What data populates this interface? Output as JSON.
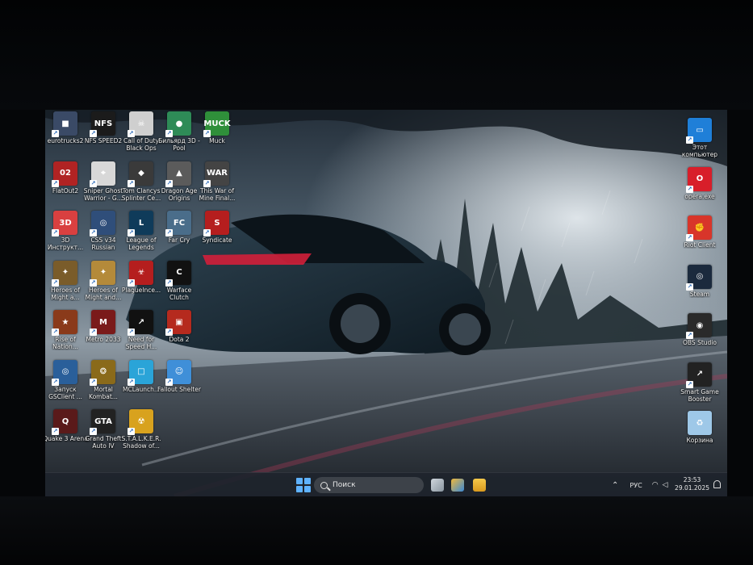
{
  "desktop_icons_left": [
    {
      "label": "eurotrucks2",
      "icon": "truck-icon",
      "color": "#3a4a66",
      "glyph": "■"
    },
    {
      "label": "NFS SPEED2",
      "icon": "nfs-icon",
      "color": "#1b1b1b",
      "glyph": "NFS"
    },
    {
      "label": "Call of Duty Black Ops",
      "icon": "skull-icon",
      "color": "#cfcfcf",
      "glyph": "☠"
    },
    {
      "label": "Бильярд 3D - Pool",
      "icon": "billiard-icon",
      "color": "#2e8b57",
      "glyph": "●"
    },
    {
      "label": "Muck",
      "icon": "muck-icon",
      "color": "#2f8f3a",
      "glyph": "MUCK"
    },
    {
      "label": "FlatOut2",
      "icon": "flatout-icon",
      "color": "#b02323",
      "glyph": "02"
    },
    {
      "label": "Sniper Ghost Warrior - G...",
      "icon": "crosshair-icon",
      "color": "#d8d8d8",
      "glyph": "⌖"
    },
    {
      "label": "Tom Clancys Splinter Ce...",
      "icon": "splinter-icon",
      "color": "#3a3a3a",
      "glyph": "◆"
    },
    {
      "label": "Dragon Age Origins",
      "icon": "dragon-icon",
      "color": "#5b5b5b",
      "glyph": "▲"
    },
    {
      "label": "This War of Mine Final...",
      "icon": "war-icon",
      "color": "#444",
      "glyph": "WAR"
    },
    {
      "label": "3D Инструкт...",
      "icon": "instructor-icon",
      "color": "#d94040",
      "glyph": "3D"
    },
    {
      "label": "CSS v34 Russian",
      "icon": "css-icon",
      "color": "#2f4e7a",
      "glyph": "◎"
    },
    {
      "label": "League of Legends",
      "icon": "lol-icon",
      "color": "#0f3b5a",
      "glyph": "L"
    },
    {
      "label": "Far Cry",
      "icon": "farcry-icon",
      "color": "#4a6d8a",
      "glyph": "FC"
    },
    {
      "label": "Syndicate",
      "icon": "syndicate-icon",
      "color": "#b51e1e",
      "glyph": "S"
    },
    {
      "label": "Heroes of Might a...",
      "icon": "heroes-icon",
      "color": "#7a5c2a",
      "glyph": "✦"
    },
    {
      "label": "Heroes of Might and...",
      "icon": "heroes2-icon",
      "color": "#b48a3a",
      "glyph": "✦"
    },
    {
      "label": "PlagueInce...",
      "icon": "biohazard-icon",
      "color": "#b51e1e",
      "glyph": "☣"
    },
    {
      "label": "Warface Clutch",
      "icon": "warface-icon",
      "color": "#111",
      "glyph": "C"
    },
    {
      "label": "",
      "icon": "empty-slot",
      "color": "",
      "glyph": ""
    },
    {
      "label": "Rise of Nation...",
      "icon": "rise-icon",
      "color": "#8a3a1a",
      "glyph": "★"
    },
    {
      "label": "Metro 2033",
      "icon": "metro-icon",
      "color": "#7a1a1a",
      "glyph": "M"
    },
    {
      "label": "Need for Speed H...",
      "icon": "nfs-hot-icon",
      "color": "#111",
      "glyph": "↗"
    },
    {
      "label": "Dota 2",
      "icon": "dota-icon",
      "color": "#b52a1e",
      "glyph": "▣"
    },
    {
      "label": "",
      "icon": "empty-slot",
      "color": "",
      "glyph": ""
    },
    {
      "label": "Запуск GSClient ...",
      "icon": "gsclient-icon",
      "color": "#2a5f9a",
      "glyph": "◎"
    },
    {
      "label": "Mortal Kombat...",
      "icon": "mk-icon",
      "color": "#8a6a1a",
      "glyph": "❂"
    },
    {
      "label": "MCLaunch...",
      "icon": "mclaunch-icon",
      "color": "#2aa4d8",
      "glyph": "□"
    },
    {
      "label": "Fallout Shelter",
      "icon": "fallout-icon",
      "color": "#3f8fd8",
      "glyph": "☺"
    },
    {
      "label": "",
      "icon": "empty-slot",
      "color": "",
      "glyph": ""
    },
    {
      "label": "Quake 3 Arena",
      "icon": "quake-icon",
      "color": "#5a1a1a",
      "glyph": "Q"
    },
    {
      "label": "Grand Theft Auto IV",
      "icon": "gta-icon",
      "color": "#222",
      "glyph": "GTA"
    },
    {
      "label": "S.T.A.L.K.E.R. Shadow of...",
      "icon": "radiation-icon",
      "color": "#d8a21e",
      "glyph": "☢"
    }
  ],
  "desktop_icons_right": [
    {
      "label": "Этот компьютер",
      "icon": "monitor-icon",
      "color": "#1f7fd8",
      "glyph": "▭"
    },
    {
      "label": "opera.exe",
      "icon": "opera-icon",
      "color": "#d81e2a",
      "glyph": "O"
    },
    {
      "label": "Riot Client",
      "icon": "riot-icon",
      "color": "#d8352a",
      "glyph": "✊"
    },
    {
      "label": "Steam",
      "icon": "steam-icon",
      "color": "#1b2a3d",
      "glyph": "◎"
    },
    {
      "label": "OBS Studio",
      "icon": "obs-icon",
      "color": "#2a2a2a",
      "glyph": "◉"
    },
    {
      "label": "Smart Game Booster",
      "icon": "booster-icon",
      "color": "#222",
      "glyph": "↗"
    },
    {
      "label": "Корзина",
      "icon": "recycle-bin-icon",
      "color": "#9ec8e8",
      "glyph": "♻"
    }
  ],
  "taskbar": {
    "search_placeholder": "Поиск",
    "language": "РУС",
    "time": "23:53",
    "date": "29.01.2025"
  }
}
